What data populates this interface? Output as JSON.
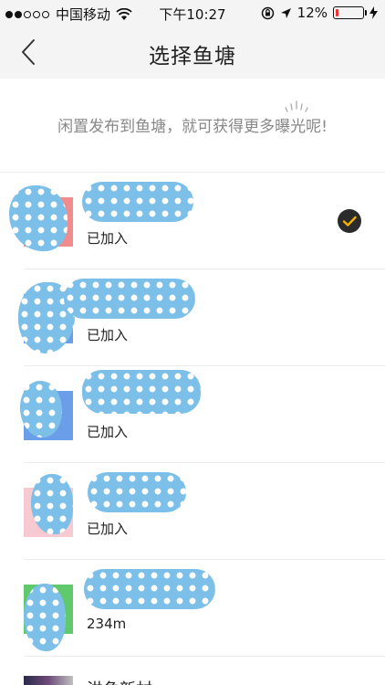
{
  "status_bar": {
    "carrier": "中国移动",
    "time": "下午10:27",
    "battery_percent": "12%",
    "battery_level": 0.12
  },
  "nav": {
    "title": "选择鱼塘"
  },
  "tip": {
    "text": "闲置发布到鱼塘，就可获得更多曝光呢!"
  },
  "ponds": [
    {
      "status": "已加入",
      "selected": true,
      "thumb_color": "#f28b8b"
    },
    {
      "status": "已加入",
      "selected": false,
      "thumb_color": "#6b9ee8"
    },
    {
      "status": "已加入",
      "selected": false,
      "thumb_color": "#6b9ee8"
    },
    {
      "status": "已加入",
      "selected": false,
      "thumb_color": "#f7c9d0"
    },
    {
      "status": "234m",
      "selected": false,
      "thumb_color": "#5fc96b"
    }
  ],
  "partial_item": {
    "label": "洪角新村"
  },
  "colors": {
    "accent": "#f5b400",
    "check_bg": "#2b2b2b",
    "redaction": "#7cbfe8"
  }
}
